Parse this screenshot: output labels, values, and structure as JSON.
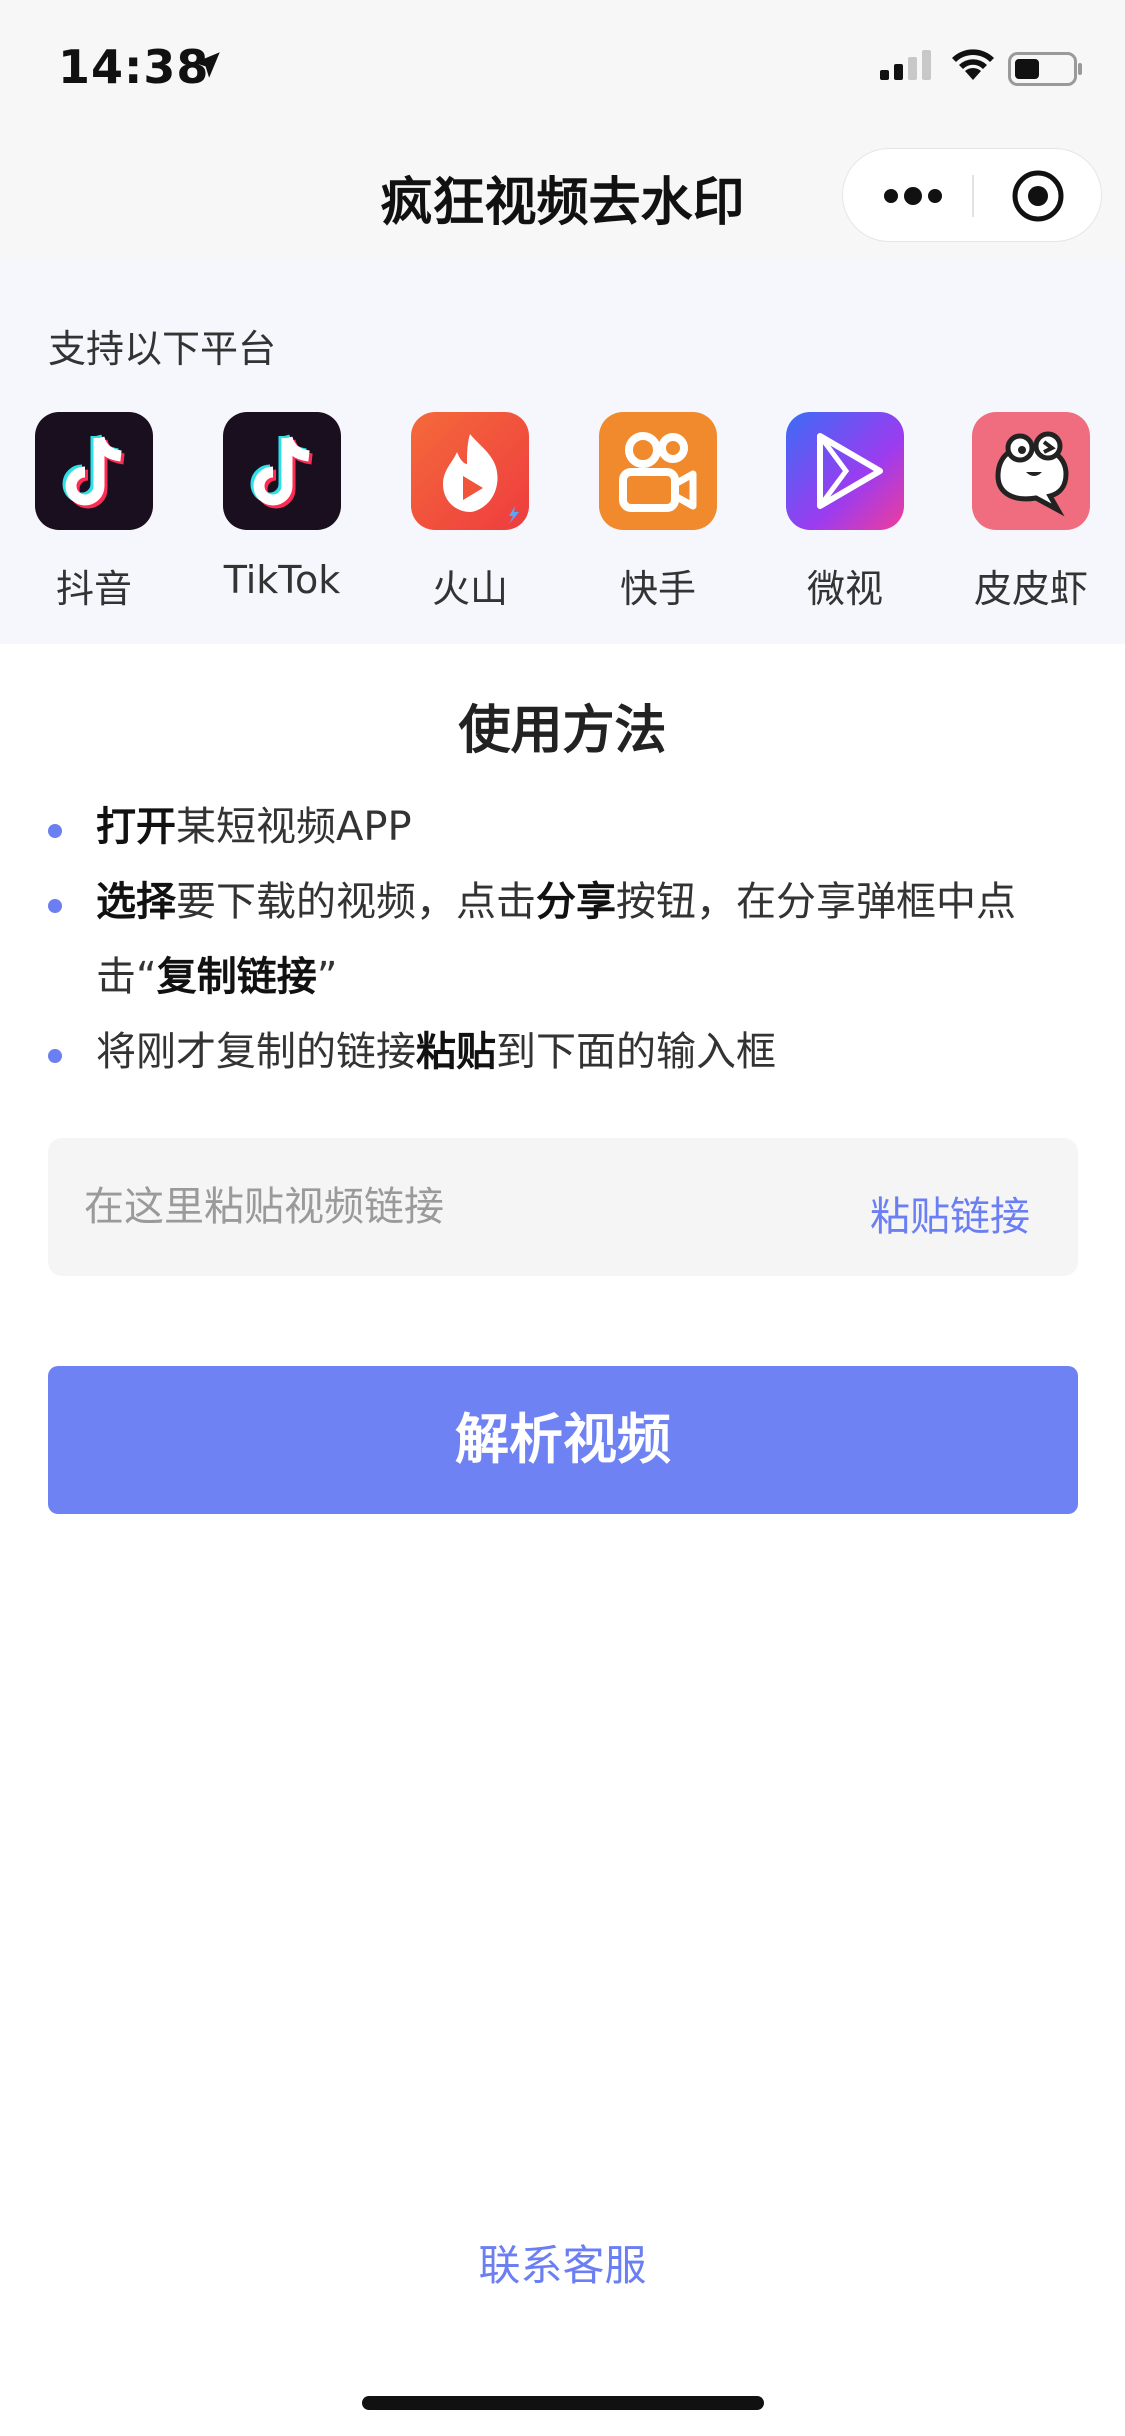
{
  "status_bar": {
    "time": "14:38",
    "icons": [
      "location-arrow-icon",
      "signal-icon",
      "wifi-icon",
      "battery-icon"
    ]
  },
  "nav": {
    "title": "疯狂视频去水印",
    "capsule_icons": [
      "more-icon",
      "close-icon"
    ]
  },
  "platforms": {
    "label": "支持以下平台",
    "items": [
      {
        "name": "抖音",
        "icon": "douyin-icon",
        "color": "#1a0f1f"
      },
      {
        "name": "TikTok",
        "icon": "tiktok-icon",
        "color": "#1a0f1f"
      },
      {
        "name": "火山",
        "icon": "huoshan-icon",
        "color": "#f3583a"
      },
      {
        "name": "快手",
        "icon": "kuaishou-icon",
        "color": "#f08a2d"
      },
      {
        "name": "微视",
        "icon": "weishi-icon",
        "color": "#7a4cf2"
      },
      {
        "name": "皮皮虾",
        "icon": "pipixia-icon",
        "color": "#ef6d7e"
      }
    ]
  },
  "usage": {
    "title": "使用方法",
    "steps": [
      {
        "b1": "打开",
        "t1": "某短视频APP"
      },
      {
        "b1": "选择",
        "t1": "要下载的视频，点击",
        "b2": "分享",
        "t2": "按钮，在分享弹框中点击“",
        "b3": "复制链接",
        "t3": "”"
      },
      {
        "t1": "将刚才复制的链接",
        "b1": "粘贴",
        "t2": "到下面的输入框"
      }
    ]
  },
  "input": {
    "placeholder": "在这里粘贴视频链接",
    "value": "",
    "paste_label": "粘贴链接"
  },
  "parse_button": "解析视频",
  "contact_label": "联系客服",
  "colors": {
    "accent": "#6b7ff3",
    "button": "#6f82f4",
    "platform_bg": "#f6f7fc"
  }
}
